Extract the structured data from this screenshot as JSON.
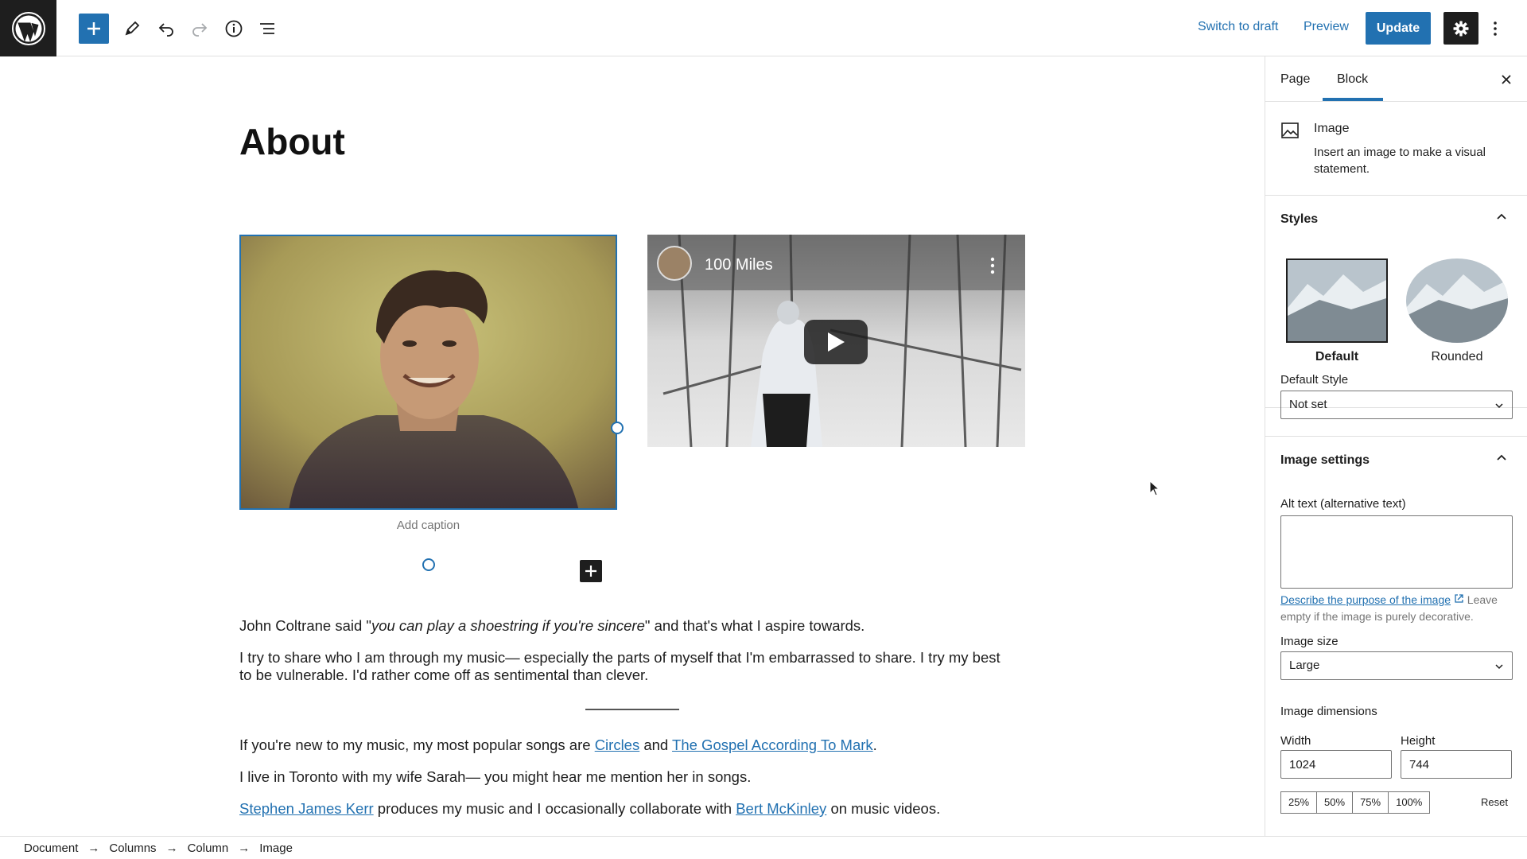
{
  "toolbar": {
    "switch_to_draft": "Switch to draft",
    "preview": "Preview",
    "update": "Update"
  },
  "editor": {
    "title": "About",
    "video": {
      "title": "100 Miles"
    },
    "image_caption_placeholder": "Add caption",
    "paragraphs": {
      "p1_a": "John Coltrane said \"",
      "p1_quote": "you can play a shoestring if you're sincere",
      "p1_b": "\" and that's what I aspire towards.",
      "p2": "I try to share who I am through my music— especially the parts of myself that I'm embarrassed to share. I try my best to be vulnerable. I'd rather come off as sentimental than clever.",
      "p3_a": "If you're new to my music, my most popular songs are ",
      "p3_link1": "Circles",
      "p3_b": " and ",
      "p3_link2": "The Gospel According To Mark",
      "p3_c": ".",
      "p4": "I live in Toronto with my wife Sarah— you might hear me mention her in songs.",
      "p5_link1": "Stephen James Kerr",
      "p5_a": " produces my music and I occasionally collaborate with ",
      "p5_link2": "Bert McKinley",
      "p5_b": " on music videos."
    }
  },
  "breadcrumb": [
    "Document",
    "Columns",
    "Column",
    "Image"
  ],
  "sidebar": {
    "tabs": {
      "page": "Page",
      "block": "Block"
    },
    "block_card": {
      "title": "Image",
      "description": "Insert an image to make a visual statement."
    },
    "styles": {
      "title": "Styles",
      "options": {
        "default": "Default",
        "rounded": "Rounded"
      },
      "default_style_label": "Default Style",
      "default_style_value": "Not set"
    },
    "image_settings": {
      "title": "Image settings",
      "alt_label": "Alt text (alternative text)",
      "alt_help_link": "Describe the purpose of the image",
      "alt_help_text": " Leave empty if the image is purely decorative.",
      "size_label": "Image size",
      "size_value": "Large",
      "dimensions_label": "Image dimensions",
      "width_label": "Width",
      "height_label": "Height",
      "width_value": "1024",
      "height_value": "744",
      "percent_buttons": [
        "25%",
        "50%",
        "75%",
        "100%"
      ],
      "reset": "Reset"
    }
  },
  "colors": {
    "accent": "#2271b1",
    "dark": "#1e1e1e",
    "border": "#e0e0e0"
  }
}
